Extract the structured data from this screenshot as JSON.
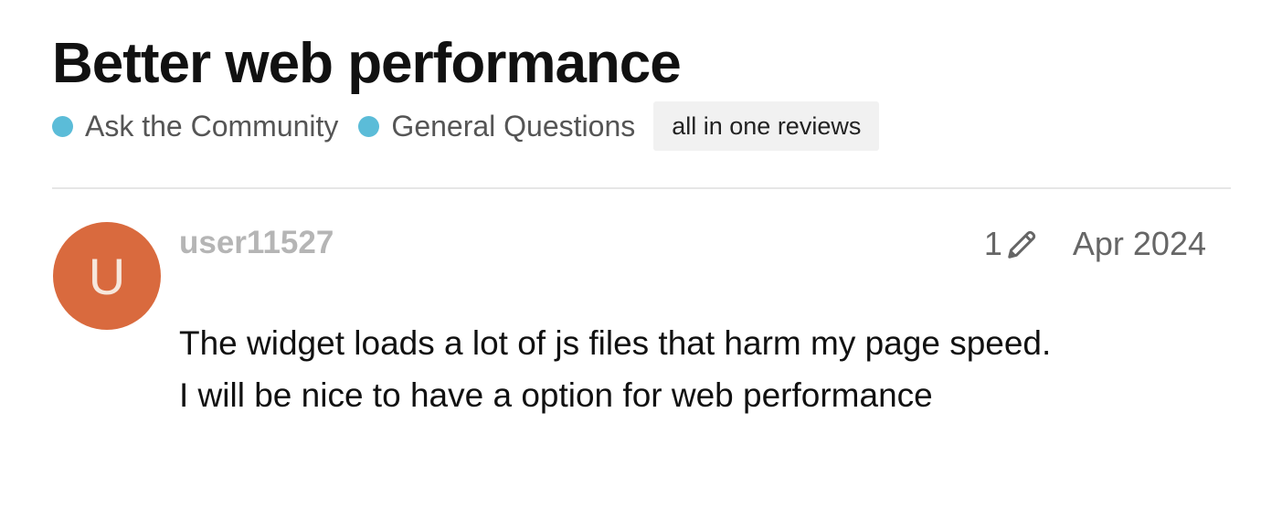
{
  "topic": {
    "title": "Better web performance"
  },
  "categories": [
    {
      "label": "Ask the Community",
      "color": "#5bbcd8"
    },
    {
      "label": "General Questions",
      "color": "#5bbcd8"
    }
  ],
  "tag": {
    "label": "all in one reviews"
  },
  "post": {
    "avatar_letter": "U",
    "avatar_color": "#d96a3e",
    "username": "user11527",
    "edit_count": "1",
    "edit_icon": "pencil-icon",
    "date": "Apr 2024",
    "body_lines": [
      "The widget loads a lot of js files that harm my page speed.",
      "I will be nice to have a option for web performance"
    ]
  }
}
